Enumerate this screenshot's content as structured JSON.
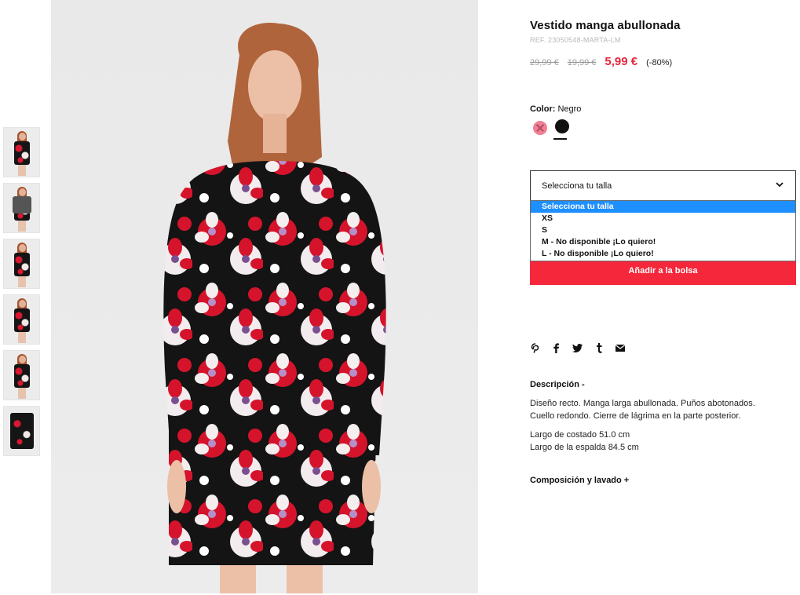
{
  "product": {
    "title": "Vestido manga abullonada",
    "ref": "REF. 23050548-MARTA-LM",
    "price_old_1": "29,99 €",
    "price_old_2": "19,99 €",
    "price_new": "5,99 €",
    "discount": "(-80%)"
  },
  "color": {
    "label": "Color:",
    "value": "Negro",
    "swatches": [
      {
        "name": "pink",
        "hex": "#ef7f95",
        "available": false
      },
      {
        "name": "black",
        "hex": "#111111",
        "selected": true
      }
    ]
  },
  "size": {
    "select_label": "Selecciona tu talla",
    "options": [
      "Selecciona tu talla",
      "XS",
      "S",
      "M - No disponible ¡Lo quiero!",
      "L - No disponible ¡Lo quiero!"
    ]
  },
  "cart": {
    "add_label": "Añadir a la bolsa"
  },
  "share": {
    "icons": [
      "pinterest-icon",
      "facebook-icon",
      "twitter-icon",
      "tumblr-icon",
      "email-icon"
    ]
  },
  "description": {
    "heading": "Descripción -",
    "text_line1": "Diseño recto. Manga larga abullonada. Puños abotonados.",
    "text_line2": "Cuello redondo. Cierre de lágrima en la parte posterior.",
    "measure1": "Largo de costado 51.0 cm",
    "measure2": "Largo de la espalda 84.5 cm"
  },
  "composition": {
    "heading": "Composición y lavado +"
  },
  "colors": {
    "accent_red": "#f5273b",
    "price_red": "#e6283a",
    "select_highlight": "#1e8fff"
  }
}
